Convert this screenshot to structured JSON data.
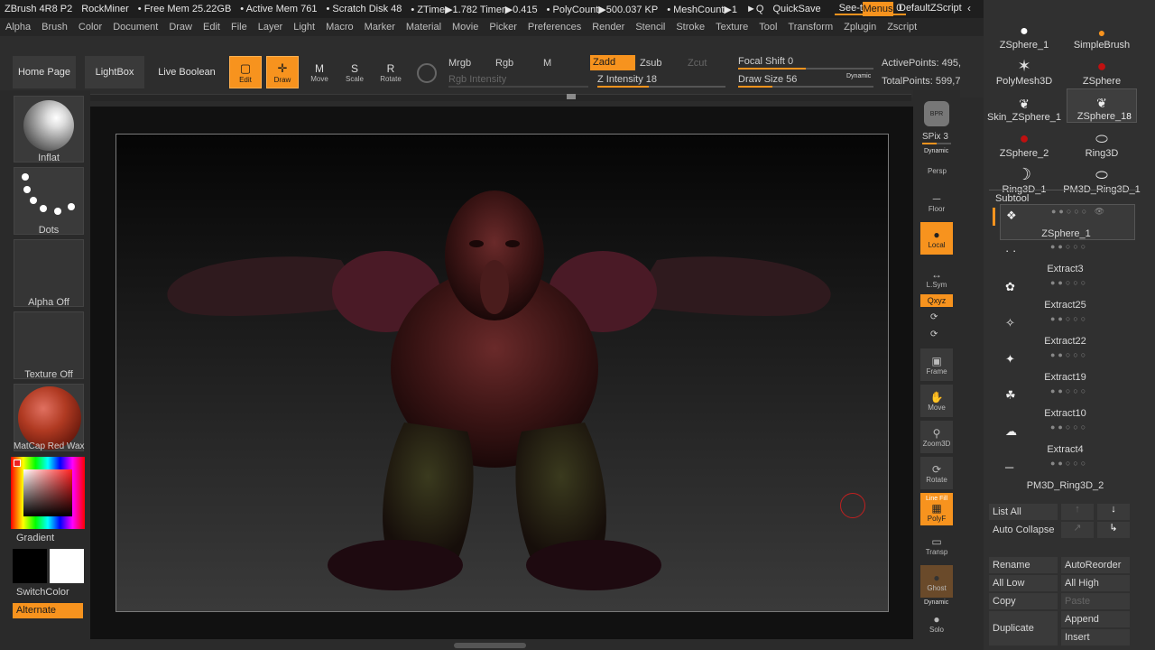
{
  "titlebar": {
    "app": "ZBrush 4R8 P2",
    "user": "RockMiner",
    "free_mem": "• Free Mem 25.22GB",
    "active_mem": "• Active Mem 761",
    "scratch": "• Scratch Disk 48",
    "ztime": "• ZTime▶1.782 Timer▶0.415",
    "polycount": "• PolyCount▶500.037 KP",
    "meshcount": "• MeshCount▶1",
    "quicksave": "QuickSave",
    "seethrough": "See-through  0",
    "menus": "Menus",
    "zscript": "DefaultZScript"
  },
  "menubar": [
    "Alpha",
    "Brush",
    "Color",
    "Document",
    "Draw",
    "Edit",
    "File",
    "Layer",
    "Light",
    "Macro",
    "Marker",
    "Material",
    "Movie",
    "Picker",
    "Preferences",
    "Render",
    "Stencil",
    "Stroke",
    "Texture",
    "Tool",
    "Transform",
    "Zplugin",
    "Zscript"
  ],
  "shelf": {
    "home": "Home Page",
    "lightbox": "LightBox",
    "liveboolean": "Live Boolean",
    "edit": "Edit",
    "draw": "Draw",
    "move": "Move",
    "scale": "Scale",
    "rotate": "Rotate",
    "mrgb": "Mrgb",
    "rgb": "Rgb",
    "m": "M",
    "zadd": "Zadd",
    "zsub": "Zsub",
    "zcut": "Zcut",
    "rgb_intensity": "Rgb Intensity",
    "z_intensity": "Z Intensity 18",
    "focal_shift": "Focal Shift 0",
    "draw_size": "Draw Size 56",
    "dynamic": "Dynamic",
    "active_points": "ActivePoints: 495,",
    "total_points": "TotalPoints: 599,7"
  },
  "left": {
    "brush": "Inflat",
    "stroke": "Dots",
    "alpha": "Alpha Off",
    "texture": "Texture Off",
    "material": "MatCap Red Wax",
    "gradient": "Gradient",
    "switchcolor": "SwitchColor",
    "alternate": "Alternate"
  },
  "rightstrip": {
    "bpr": "BPR",
    "spix": "SPix 3",
    "persp": "Persp",
    "dynamic": "Dynamic",
    "floor": "Floor",
    "local": "Local",
    "lsym": "L.Sym",
    "xyz": "Qxyz",
    "frame": "Frame",
    "move": "Move",
    "zoom3d": "Zoom3D",
    "rotate": "Rotate",
    "linefill": "Line Fill",
    "polyf": "PolyF",
    "transp": "Transp",
    "ghost": "Ghost",
    "solo_dyn": "Dynamic",
    "solo": "Solo"
  },
  "tools": [
    {
      "label": "ZSphere_1"
    },
    {
      "label": "SimpleBrush"
    },
    {
      "label": "PolyMesh3D"
    },
    {
      "label": "ZSphere"
    },
    {
      "label": "Skin_ZSphere_1"
    },
    {
      "label": "ZSphere_1",
      "badge": "8"
    },
    {
      "label": "ZSphere_2"
    },
    {
      "label": "Ring3D"
    },
    {
      "label": "Ring3D_1"
    },
    {
      "label": "PM3D_Ring3D_1"
    }
  ],
  "subtool": {
    "title": "Subtool",
    "items": [
      "ZSphere_1",
      "Extract3",
      "Extract25",
      "Extract22",
      "Extract19",
      "Extract10",
      "Extract4",
      "PM3D_Ring3D_2"
    ]
  },
  "subtool_buttons": {
    "list_all": "List All",
    "auto_collapse": "Auto Collapse",
    "rename": "Rename",
    "autoreorder": "AutoReorder",
    "all_low": "All Low",
    "all_high": "All High",
    "copy": "Copy",
    "paste": "Paste",
    "duplicate": "Duplicate",
    "append": "Append",
    "insert": "Insert"
  },
  "colors": {
    "accent": "#f7931e",
    "panel": "#303030",
    "canvas": "#111111"
  }
}
